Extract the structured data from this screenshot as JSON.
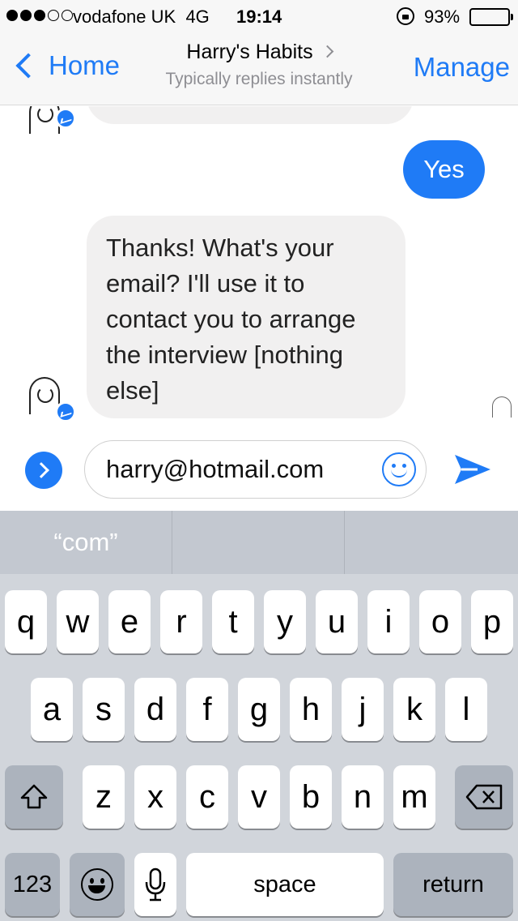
{
  "status_bar": {
    "carrier": "vodafone UK",
    "network": "4G",
    "time": "19:14",
    "battery": "93%",
    "battery_level": 0.93,
    "signal_bars_filled": 3,
    "signal_bars_total": 5
  },
  "nav": {
    "back_label": "Home",
    "title": "Harry's Habits",
    "subtitle": "Typically replies instantly",
    "manage_label": "Manage"
  },
  "chat": {
    "messages": [
      {
        "sender": "user",
        "text": "Yes"
      },
      {
        "sender": "bot",
        "text": "Thanks! What's your email? I'll use it to contact you to arrange the interview [nothing else]"
      }
    ]
  },
  "composer": {
    "value": "harry@hotmail.com",
    "icons": [
      "chevron-right-icon",
      "emoji-icon",
      "send-icon"
    ]
  },
  "keyboard": {
    "suggestions": [
      "“com”",
      "",
      ""
    ],
    "row1": [
      "q",
      "w",
      "e",
      "r",
      "t",
      "y",
      "u",
      "i",
      "o",
      "p"
    ],
    "row2": [
      "a",
      "s",
      "d",
      "f",
      "g",
      "h",
      "j",
      "k",
      "l"
    ],
    "row3": [
      "z",
      "x",
      "c",
      "v",
      "b",
      "n",
      "m"
    ],
    "numbers_label": "123",
    "space_label": "space",
    "return_label": "return"
  },
  "colors": {
    "accent": "#1f7bf6",
    "bot_bubble": "#f1f0f0",
    "keyboard_bg": "#d1d5db",
    "dark_key": "#acb3bd"
  }
}
